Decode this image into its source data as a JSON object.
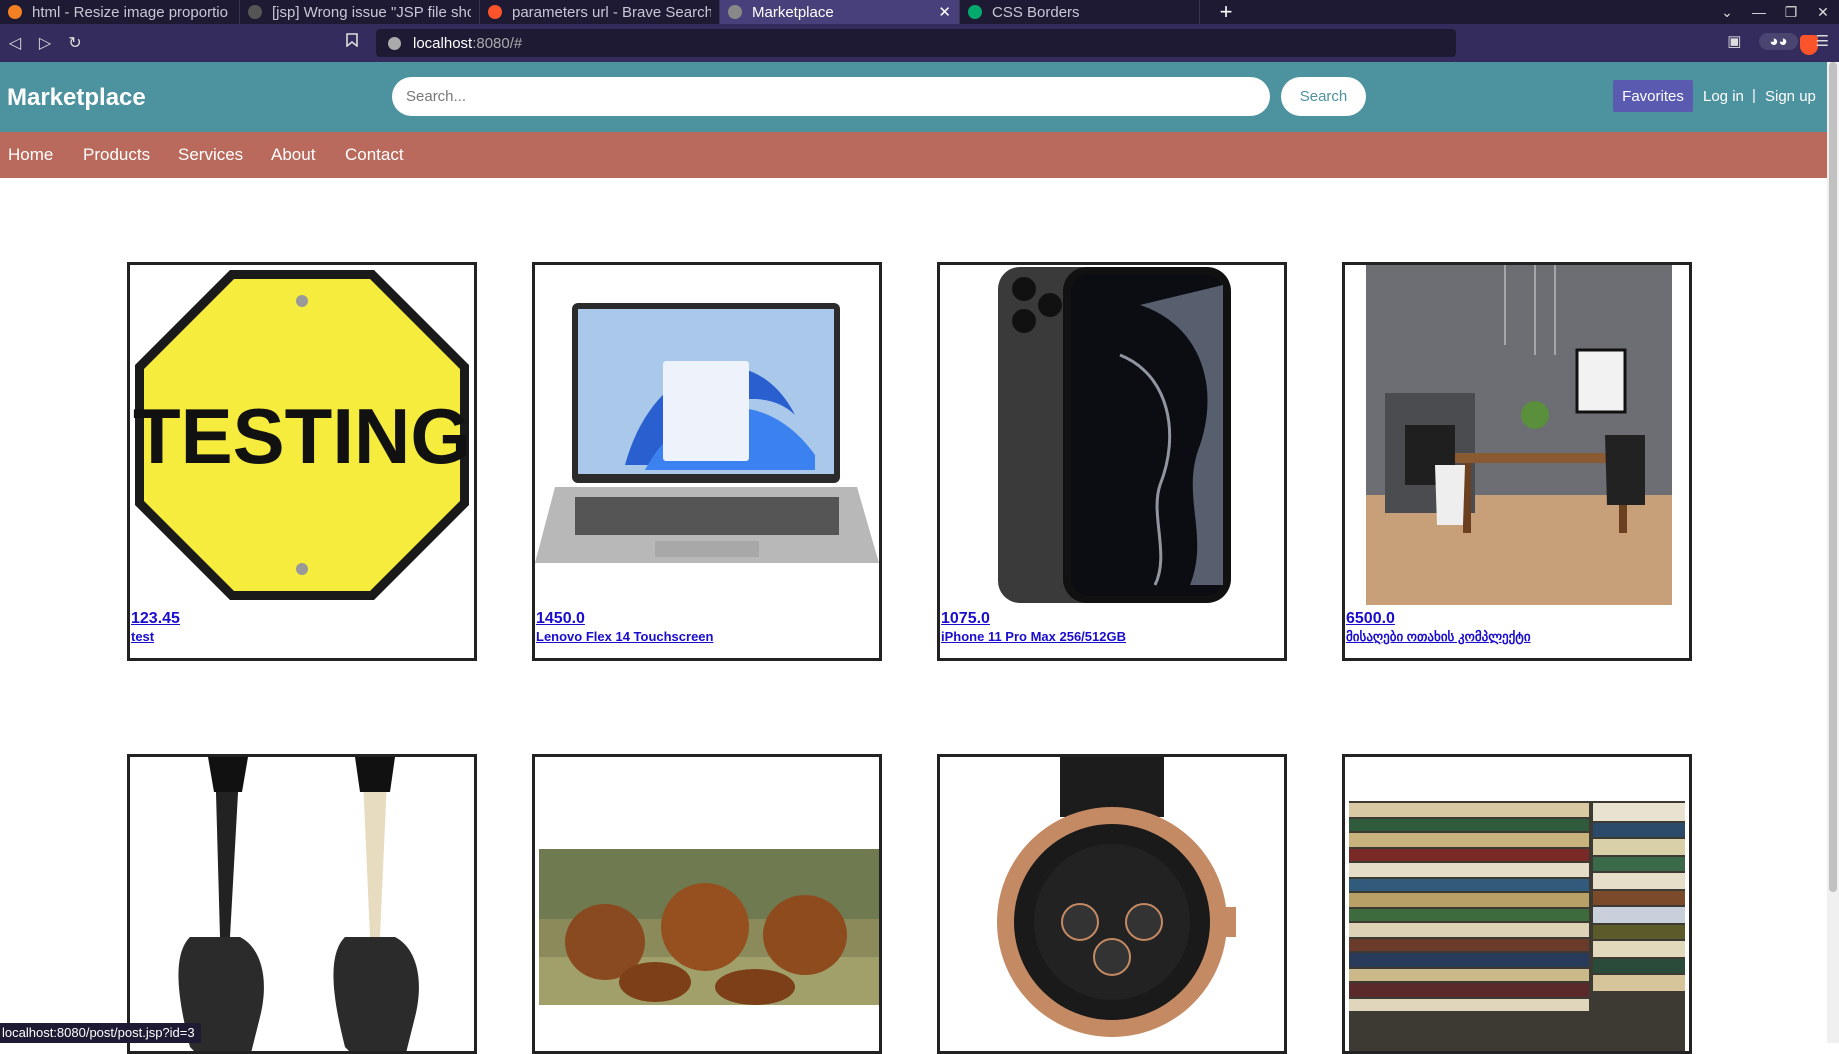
{
  "browser": {
    "tabs": [
      {
        "label": "html - Resize image proportio",
        "icon_color": "#f48024",
        "active": false
      },
      {
        "label": "[jsp] Wrong issue \"JSP file sho",
        "icon_color": "#333333",
        "active": false
      },
      {
        "label": "parameters url - Brave Search",
        "icon_color": "#fb542b",
        "active": false
      },
      {
        "label": "Marketplace",
        "icon_color": "#777777",
        "active": true
      },
      {
        "label": "CSS Borders",
        "icon_color": "#04aa6d",
        "active": false
      }
    ],
    "url_host": "localhost",
    "url_path": ":8080/#",
    "status_url": "localhost:8080/post/post.jsp?id=3"
  },
  "site": {
    "logo": "Marketplace",
    "search_placeholder": "Search...",
    "search_button": "Search",
    "favorites": "Favorites",
    "login": "Log in",
    "separator": "|",
    "signup": "Sign up",
    "colors": {
      "header": "#4c929f",
      "nav": "#b96a5c",
      "favorites": "#5a5ab0",
      "link": "#1a0dcc"
    }
  },
  "nav": [
    "Home",
    "Products",
    "Services",
    "About",
    "Contact"
  ],
  "products": [
    {
      "price": "123.45",
      "title": "test",
      "image": "testing-sign"
    },
    {
      "price": "1450.0",
      "title": "Lenovo Flex 14 Touchscreen",
      "image": "laptop"
    },
    {
      "price": "1075.0",
      "title": "iPhone 11 Pro Max 256/512GB",
      "image": "iphone"
    },
    {
      "price": "6500.0",
      "title": "მისაღები ოთახის კომპლექტი",
      "image": "dining-room"
    },
    {
      "price": "",
      "title": "",
      "image": "guitars"
    },
    {
      "price": "",
      "title": "",
      "image": "puppies"
    },
    {
      "price": "",
      "title": "",
      "image": "watch"
    },
    {
      "price": "",
      "title": "",
      "image": "books"
    }
  ],
  "testing_sign_text": "TESTING"
}
